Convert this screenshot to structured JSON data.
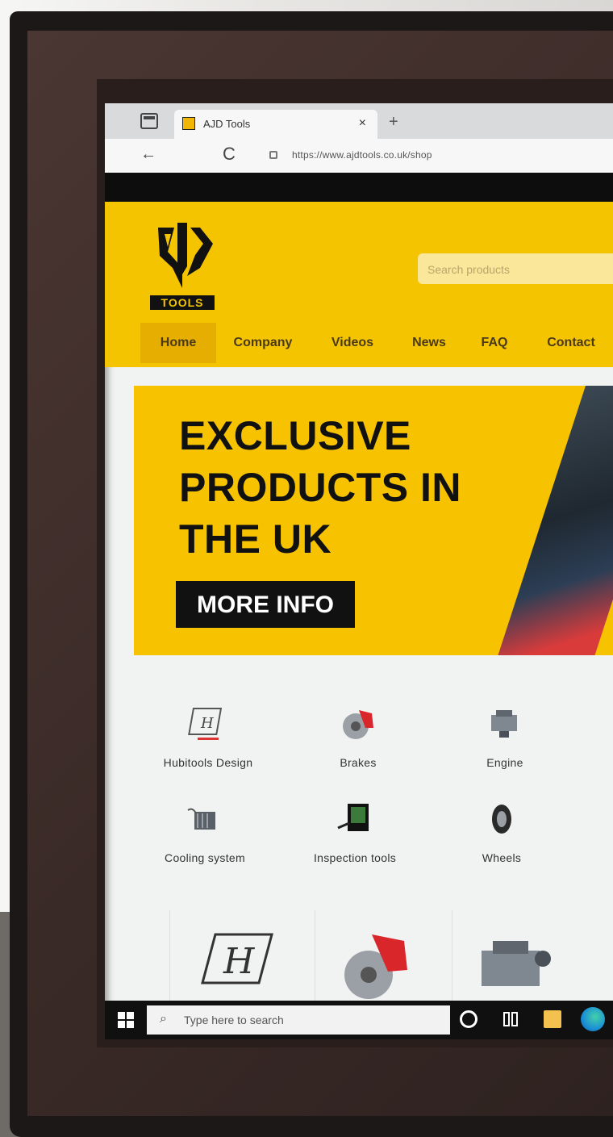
{
  "browser": {
    "tab_title": "AJD Tools",
    "tab_close": "×",
    "new_tab": "+",
    "back": "←",
    "reload": "C",
    "url": "https://www.ajdtools.co.uk/shop"
  },
  "site": {
    "logo_text": "TOOLS",
    "search_placeholder": "Search products",
    "nav": [
      "Home",
      "Company",
      "Videos",
      "News",
      "FAQ",
      "Contact"
    ],
    "active_nav": "Home"
  },
  "hero": {
    "title_line1": "EXCLUSIVE",
    "title_line2": "PRODUCTS IN",
    "title_line3": "THE UK",
    "button": "MORE INFO"
  },
  "categories": [
    {
      "label": "Hubitools Design",
      "icon": "hubitools-design-icon"
    },
    {
      "label": "Brakes",
      "icon": "brake-icon"
    },
    {
      "label": "Engine",
      "icon": "engine-icon"
    },
    {
      "label": "Cooling system",
      "icon": "cooling-system-icon"
    },
    {
      "label": "Inspection tools",
      "icon": "inspection-tool-icon"
    },
    {
      "label": "Wheels",
      "icon": "wheel-icon"
    }
  ],
  "taskbar": {
    "search_placeholder": "Type here to search"
  },
  "colors": {
    "brand_yellow": "#f5c400",
    "brand_black": "#111111"
  }
}
